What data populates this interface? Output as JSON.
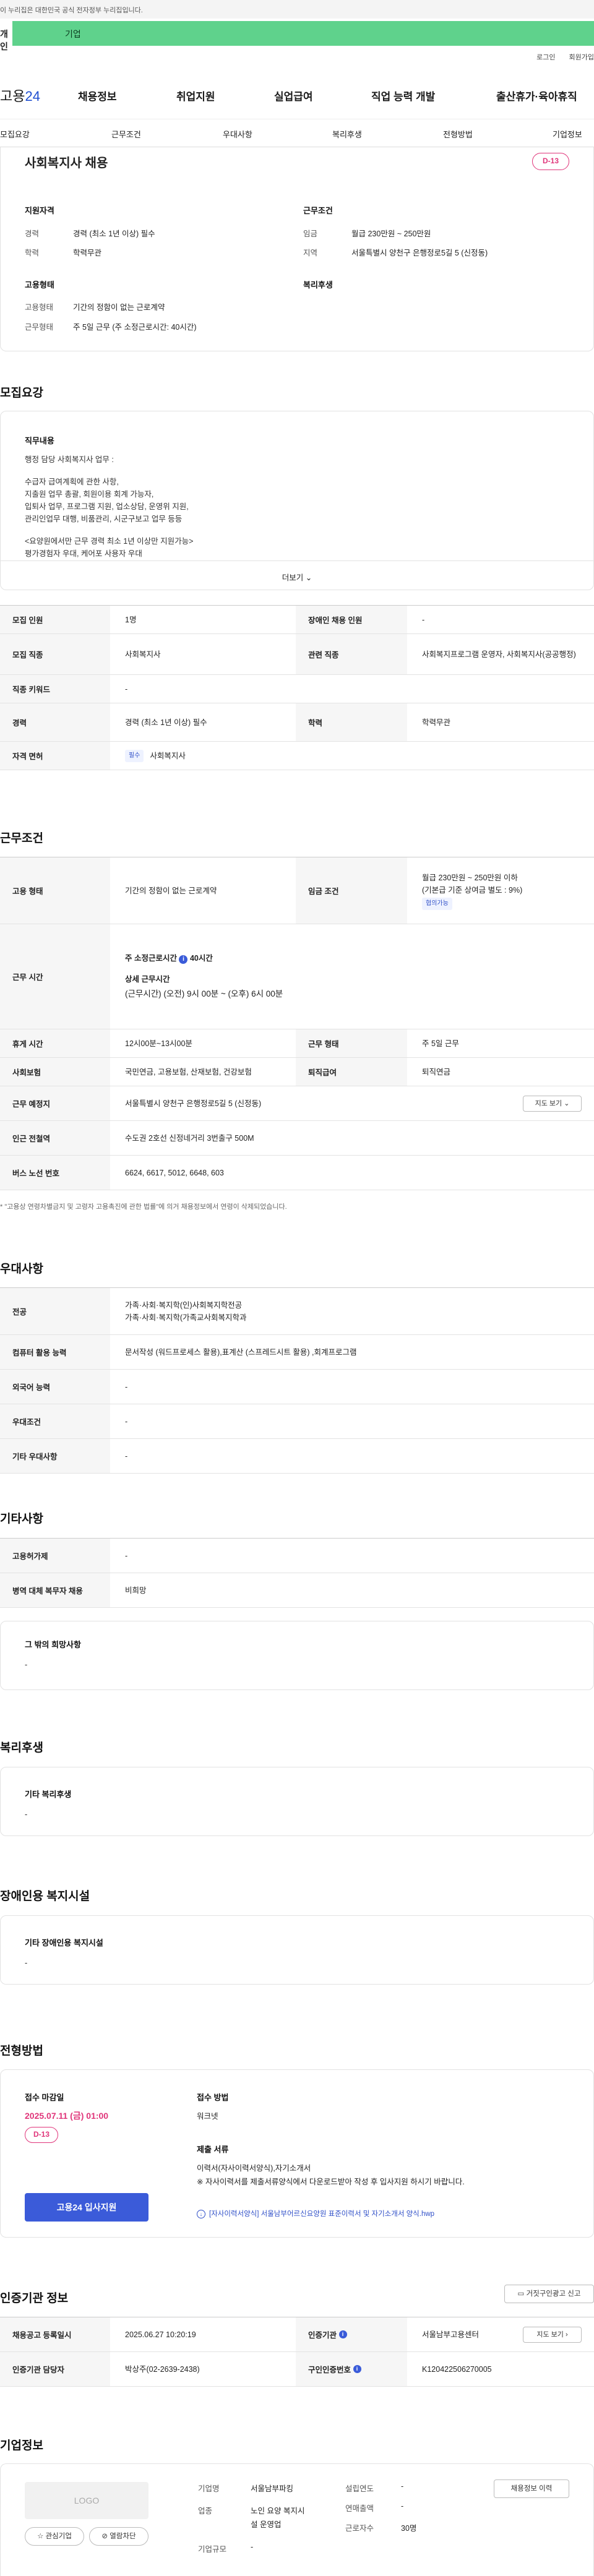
{
  "top": {
    "gov_notice": "이 누리집은 대한민국 공식 전자정부 누리집입니다.",
    "tab_personal": "개인",
    "tab_company": "기업",
    "login": "로그인",
    "signup": "회원가입"
  },
  "header": {
    "logo_main": "고용",
    "logo_num": "24",
    "gnb": [
      "채용정보",
      "취업지원",
      "실업급여",
      "직업 능력 개발",
      "출산휴가·육아휴직"
    ]
  },
  "subnav": [
    "모집요강",
    "근무조건",
    "우대사항",
    "복리후생",
    "전형방법",
    "기업정보"
  ],
  "summary": {
    "title": "사회복지사 채용",
    "dday": "D-13",
    "qualification_title": "지원자격",
    "career_label": "경력",
    "career_value": "경력 (최소 1년 이상) 필수",
    "edu_label": "학력",
    "edu_value": "학력무관",
    "employ_title": "고용형태",
    "employ_label": "고용형태",
    "employ_value": "기간의 정함이 없는 근로계약",
    "work_label": "근무형태",
    "work_value": "주 5일 근무 (주 소정근로시간: 40시간)",
    "cond_title": "근무조건",
    "wage_label": "임금",
    "wage_value": "월급 230만원 ~ 250만원",
    "region_label": "지역",
    "region_value": "서울특별시 양천구 은행정로5길 5 (신정동)",
    "welfare_title": "복리후생"
  },
  "recruit": {
    "section_title": "모집요강",
    "job_desc_title": "직무내용",
    "job_desc_lines": [
      "행정 담당 사회복지사 업무 :",
      "",
      "수급자 급여계획에 관한 사항,",
      "지출원 업무 총괄, 회원이용 회계 가능자,",
      "입퇴사 업무, 프로그램 지원, 업소상담, 운영위 지원,",
      "관리인업무 대행, 비품관리, 시군구보고 업무 등등",
      "",
      "<요양원에서만 근무 경력 최소 1년 이상만 지원가능>",
      "평가경험자 우대, 케어포 사용자 우대"
    ],
    "more_label": "더보기",
    "rows": {
      "count_label": "모집 인원",
      "count_value": "1명",
      "disabled_label": "장애인 채용 인원",
      "disabled_value": "-",
      "job_label": "모집 직종",
      "job_value": "사회복지사",
      "related_label": "관련 직종",
      "related_value": "사회복지프로그램 운영자, 사회복지사(공공행정)",
      "keyword_label": "직종 키워드",
      "keyword_value": "-",
      "career_label": "경력",
      "career_value": "경력 (최소 1년 이상) 필수",
      "edu_label": "학력",
      "edu_value": "학력무관",
      "license_label": "자격 면허",
      "license_tag": "필수",
      "license_value": "사회복지사"
    }
  },
  "conditions": {
    "section_title": "근무조건",
    "employ_label": "고용 형태",
    "employ_value": "기간의 정함이 없는 근로계약",
    "wage_label": "임금 조건",
    "wage_value": "월급 230만원 ~ 250만원 이하",
    "wage_sub": "(기본급 기준 상여금 별도 : 9%)",
    "wage_tag": "협의가능",
    "hours_label": "근무 시간",
    "hours_weekly": "주 소정근로시간",
    "hours_weekly_value": "40시간",
    "hours_detail_title": "상세 근무시간",
    "hours_detail_value": "(근무시간) (오전) 9시 00분 ~ (오후) 6시 00분",
    "rest_label": "휴게 시간",
    "rest_value": "12시00분~13시00분",
    "type_label": "근무 형태",
    "type_value": "주 5일 근무",
    "insurance_label": "사회보험",
    "insurance_value": "국민연금, 고용보험, 산재보험, 건강보험",
    "pension_label": "퇴직급여",
    "pension_value": "퇴직연금",
    "location_label": "근무 예정지",
    "location_value": "서울특별시 양천구 은행정로5길 5 (신정동)",
    "map_button": "지도 보기",
    "subway_label": "인근 전철역",
    "subway_value": "수도권 2호선 신정네거리 3번출구 500M",
    "bus_label": "버스 노선 번호",
    "bus_value": "6624, 6617, 5012, 6648, 603",
    "note": "* \"고용상 연령차별금지 및 고령자 고용촉진에 관한 법률\"에 의거 채용정보에서 연령이 삭제되었습니다."
  },
  "preference": {
    "section_title": "우대사항",
    "major_label": "전공",
    "major_value_1": "가족·사회·복지학(인)사회복지학전공",
    "major_value_2": "가족·사회·복지학(가족교사회복지학과",
    "computer_label": "컴퓨터 활용 능력",
    "computer_value": "문서작성 (워드프로세스 활용),표계산 (스프레드시트 활용) ,회계프로그램",
    "lang_label": "외국어 능력",
    "lang_value": "-",
    "pref_label": "우대조건",
    "pref_value": "-",
    "etc_label": "기타 우대사항",
    "etc_value": "-"
  },
  "other": {
    "section_title": "기타사항",
    "permit_label": "고용허가제",
    "permit_value": "-",
    "military_label": "병역 대체 복무자 채용",
    "military_value": "비희망",
    "hope_title": "그 밖의 희망사항",
    "hope_value": "-"
  },
  "welfare": {
    "section_title": "복리후생",
    "etc_title": "기타 복리후생",
    "etc_value": "-"
  },
  "disabled": {
    "section_title": "장애인용 복지시설",
    "etc_title": "기타 장애인용 복지시설",
    "etc_value": "-"
  },
  "selection": {
    "section_title": "전형방법",
    "deadline_title": "접수 마감일",
    "deadline_value": "2025.07.11 (금) 01:00",
    "dday": "D-13",
    "apply_button": "고용24 입사지원",
    "method_title": "접수 방법",
    "method_value": "워크넷",
    "docs_title": "제출 서류",
    "docs_line_1": "이력서(자사이력서양식),자기소개서",
    "docs_line_2": "※ 자사이력서를 제출서류양식에서 다운로드받아 작성 후 입사지원 하시기 바랍니다.",
    "download_link": "[자사이력서양식] 서울남부어르신요양원 표준이력서 및 자기소개서 양식.hwp"
  },
  "cert": {
    "section_title": "인증기관 정보",
    "report_button": "거짓구인광고 신고",
    "reg_label": "채용공고 등록일시",
    "reg_value": "2025.06.27 10:20:19",
    "agency_label": "인증기관",
    "agency_value": "서울남부고용센터",
    "map_button": "지도 보기",
    "manager_label": "인증기관 담당자",
    "manager_value": "박상주(02-2639-2438)",
    "cert_no_label": "구인인증번호",
    "cert_no_value": "K120422506270005"
  },
  "company": {
    "section_title": "기업정보",
    "logo_placeholder": "LOGO",
    "fav_button": "관심기업",
    "block_button": "열람차단",
    "name_label": "기업명",
    "name_value": "서울남부파킹",
    "industry_label": "업종",
    "industry_value_1": "노인 요양 복지시",
    "industry_value_2": "설 운영업",
    "size_label": "기업규모",
    "size_value": "-",
    "founded_label": "설립연도",
    "founded_value": "-",
    "sales_label": "연매출액",
    "sales_value": "-",
    "emp_label": "근로자수",
    "emp_value": "30명",
    "history_button": "채용정보 이력"
  }
}
